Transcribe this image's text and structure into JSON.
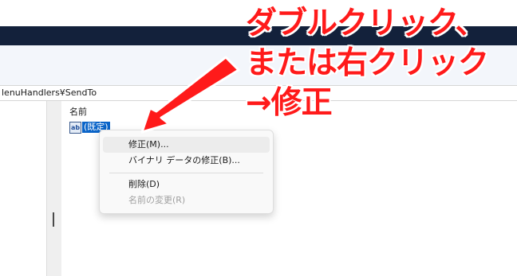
{
  "address": {
    "path": "lenuHandlers¥SendTo"
  },
  "list": {
    "column_name": "名前",
    "value_icon": "ab",
    "value_name": "(既定)"
  },
  "context_menu": {
    "items": [
      {
        "label": "修正(M)...",
        "highlighted": true,
        "enabled": true
      },
      {
        "label": "バイナリ データの修正(B)...",
        "highlighted": false,
        "enabled": true
      },
      {
        "label": "削除(D)",
        "highlighted": false,
        "enabled": true
      },
      {
        "label": "名前の変更(R)",
        "highlighted": false,
        "enabled": false
      }
    ]
  },
  "annotation": {
    "line1": "ダブルクリック、",
    "line2": "または右クリック",
    "line3": "→修正",
    "color": "#ff1a1a"
  }
}
